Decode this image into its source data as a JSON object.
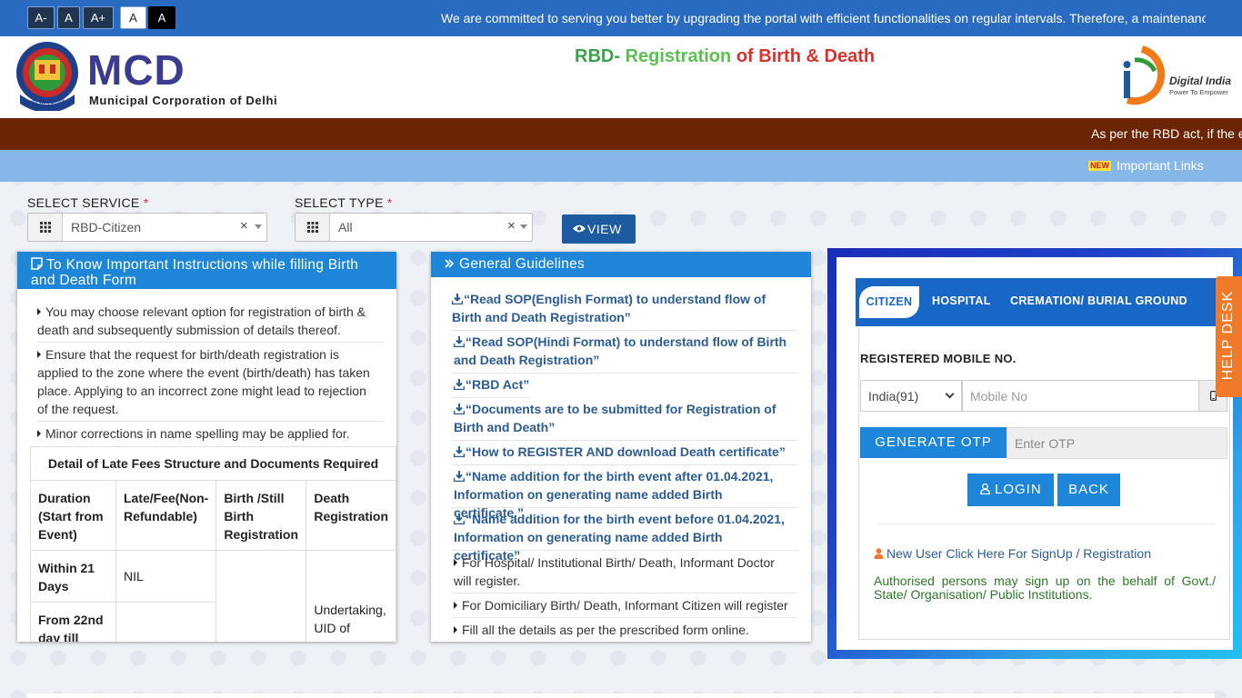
{
  "accessibility": {
    "decrease": "A-",
    "normal": "A",
    "increase": "A+",
    "light_theme": "A",
    "dark_theme": "A"
  },
  "top_marquee": "We are committed to serving you better by upgrading the portal with efficient functionalities on regular intervals. Therefore, a maintenance",
  "header": {
    "mcd_title": "MCD",
    "mcd_subtitle": "Municipal Corporation of Delhi",
    "emblem_motto": "तमसो मा ज्योतिर्गमय",
    "rbd_prefix": "RBD-",
    "rbd_registration": "Registration",
    "rbd_of": "of",
    "rbd_birth": "Birth",
    "rbd_amp": "&",
    "rbd_death": "Death",
    "digital_india_title": "Digital India",
    "digital_india_tagline": "Power To Empower"
  },
  "brown_marquee": "As per the RBD act, if the e",
  "important_links": {
    "badge": "NEW",
    "label": "Important Links"
  },
  "filters": {
    "service_label": "SELECT SERVICE",
    "service_value": "RBD-Citizen",
    "type_label": "SELECT TYPE",
    "type_value": "All",
    "required_mark": "*",
    "clear_symbol": "×",
    "view_label": "VIEW"
  },
  "instructions": {
    "title": "To Know Important Instructions while filling Birth and Death Form",
    "items": [
      "You may choose relevant option for registration of birth & death and subsequently submission of details thereof.",
      "Ensure that the request for birth/death registration is applied to the zone where the event (birth/death) has taken place. Applying to an incorrect zone might lead to rejection of the request.",
      "Minor corrections in name spelling may be applied for."
    ],
    "table": {
      "caption": "Detail of Late Fees Structure and Documents Required",
      "headers": [
        "Duration (Start from Event)",
        "Late/Fee(Non-Refundable)",
        "Birth /Still Birth Registration",
        "Death Registration"
      ],
      "rows": [
        [
          "Within 21 Days",
          "NIL",
          "",
          "Undertaking, UID of"
        ],
        [
          "From 22nd day till",
          "",
          "",
          ""
        ]
      ]
    }
  },
  "guidelines": {
    "title": "General Guidelines",
    "links": [
      "“Read SOP(English Format) to understand flow of Birth and Death Registration”",
      "“Read SOP(Hindi Format) to understand flow of Birth and Death Registration”",
      "“RBD Act”",
      "“Documents are to be submitted for Registration of Birth and Death”",
      "“How to REGISTER AND download Death certificate”",
      "“Name addition for the birth event after 01.04.2021, Information on generating name added Birth certificate.”",
      "“Name addition for the birth event before 01.04.2021, Information on generating name added Birth certificate”"
    ],
    "notes": [
      "For Hospital/ Institutional Birth/ Death, Informant Doctor will register.",
      "For Domiciliary Birth/ Death, Informant Citizen will register",
      "Fill all the details as per the prescribed form online."
    ]
  },
  "login": {
    "tabs": [
      "CITIZEN",
      "HOSPITAL",
      "CREMATION/ BURIAL GROUND"
    ],
    "mobile_label": "REGISTERED MOBILE NO.",
    "country_code": "India(91)",
    "mobile_placeholder": "Mobile No",
    "generate_otp": "GENERATE OTP",
    "otp_placeholder": "Enter OTP",
    "login_label": "LOGIN",
    "back_label": "BACK",
    "new_user_link": "New User Click Here For SignUp / Registration",
    "authorised_note": "Authorised persons may sign up on the behalf of Govt./ State/ Organisation/ Public Institutions."
  },
  "helpdesk_label": "HELP DESK",
  "colors": {
    "top_blue": "#2a6bc2",
    "brown": "#6b2405",
    "light_blue": "#87b6e8",
    "panel_blue": "#1d86d8",
    "link_blue": "#2b5c93",
    "green_note": "#2c7a26",
    "helpdesk_orange": "#f07a2a"
  }
}
